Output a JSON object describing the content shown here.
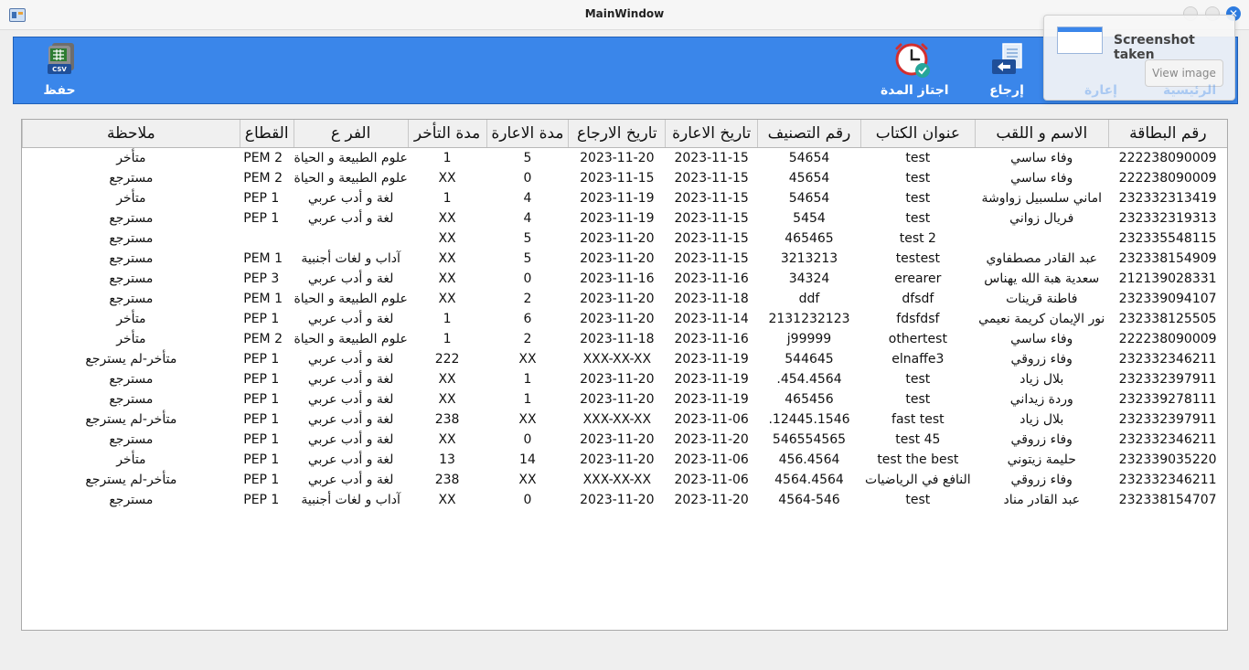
{
  "window": {
    "title": "MainWindow"
  },
  "toolbar": {
    "save_label": "حفظ",
    "overdue_label": "اجتاز المدة",
    "return_label": "إرجاع",
    "loan_label": "إعارة",
    "home_label": "الرئيسية"
  },
  "notification": {
    "title": "Screenshot taken",
    "button": "View image"
  },
  "table": {
    "headers": [
      "رقم البطاقة",
      "الاسم و اللقب",
      "عنوان الكتاب",
      "رقم التصنيف",
      "تاريخ الاعارة",
      "تاريخ الارجاع",
      "مدة الاعارة",
      "مدة التأخر",
      "الفر ع",
      "القطاع",
      "ملاحظة"
    ],
    "rows": [
      [
        "222238090009",
        "وفاء ساسي",
        "test",
        "54654",
        "2023-11-15",
        "2023-11-20",
        "5",
        "1",
        "علوم الطبيعة و الحياة",
        "PEM 2",
        "متأخر"
      ],
      [
        "222238090009",
        "وفاء ساسي",
        "test",
        "45654",
        "2023-11-15",
        "2023-11-15",
        "0",
        "XX",
        "علوم الطبيعة و الحياة",
        "PEM 2",
        "مسترجع"
      ],
      [
        "232332313419",
        "اماني سلسبيل زواوشة",
        "test",
        "54654",
        "2023-11-15",
        "2023-11-19",
        "4",
        "1",
        "لغة و أدب عربي",
        "PEP 1",
        "متأخر"
      ],
      [
        "232332319313",
        "فريال زواني",
        "test",
        "5454",
        "2023-11-15",
        "2023-11-19",
        "4",
        "XX",
        "لغة و أدب عربي",
        "PEP 1",
        "مسترجع"
      ],
      [
        "232335548115",
        "",
        "test 2",
        "465465",
        "2023-11-15",
        "2023-11-20",
        "5",
        "XX",
        "",
        "",
        "مسترجع"
      ],
      [
        "232338154909",
        "عبد القادر مصطفاوي",
        "testest",
        "3213213",
        "2023-11-15",
        "2023-11-20",
        "5",
        "XX",
        "آداب و لغات أجنبية",
        "PEM 1",
        "مسترجع"
      ],
      [
        "212139028331",
        "سعدية هبة الله يهناس",
        "erearer",
        "34324",
        "2023-11-16",
        "2023-11-16",
        "0",
        "XX",
        "لغة و أدب عربي",
        "PEP 3",
        "مسترجع"
      ],
      [
        "232339094107",
        "فاطنة قرينات",
        "dfsdf",
        "ddf",
        "2023-11-18",
        "2023-11-20",
        "2",
        "XX",
        "علوم الطبيعة و الحياة",
        "PEM 1",
        "مسترجع"
      ],
      [
        "232338125505",
        "نور الإيمان كريمة نعيمي",
        "fdsfdsf",
        "2131232123",
        "2023-11-14",
        "2023-11-20",
        "6",
        "1",
        "لغة و أدب عربي",
        "PEP 1",
        "متأخر"
      ],
      [
        "222238090009",
        "وفاء ساسي",
        "othertest",
        "j99999",
        "2023-11-16",
        "2023-11-18",
        "2",
        "1",
        "علوم الطبيعة و الحياة",
        "PEM 2",
        "متأخر"
      ],
      [
        "232332346211",
        "وفاء زروقي",
        "elnaffe3",
        "544645",
        "2023-11-19",
        "XXX-XX-XX",
        "XX",
        "222",
        "لغة و أدب عربي",
        "PEP 1",
        "متأخر-لم يسترجع"
      ],
      [
        "232332397911",
        "بلال زياد",
        "test",
        "454.4564.",
        "2023-11-19",
        "2023-11-20",
        "1",
        "XX",
        "لغة و أدب عربي",
        "PEP 1",
        "مسترجع"
      ],
      [
        "232339278111",
        "وردة زيداني",
        "test",
        "465456",
        "2023-11-19",
        "2023-11-20",
        "1",
        "XX",
        "لغة و أدب عربي",
        "PEP 1",
        "مسترجع"
      ],
      [
        "232332397911",
        "بلال زياد",
        "fast test",
        "12445.1546.",
        "2023-11-06",
        "XXX-XX-XX",
        "XX",
        "238",
        "لغة و أدب عربي",
        "PEP 1",
        "متأخر-لم يسترجع"
      ],
      [
        "232332346211",
        "وفاء زروقي",
        "test 45",
        "546554565",
        "2023-11-20",
        "2023-11-20",
        "0",
        "XX",
        "لغة و أدب عربي",
        "PEP 1",
        "مسترجع"
      ],
      [
        "232339035220",
        "حليمة زيتوني",
        "test the best",
        "456.4564",
        "2023-11-06",
        "2023-11-20",
        "14",
        "13",
        "لغة و أدب عربي",
        "PEP 1",
        "متأخر"
      ],
      [
        "232332346211",
        "وفاء زروقي",
        "النافع في الرياضيات",
        "4564.4564",
        "2023-11-06",
        "XXX-XX-XX",
        "XX",
        "238",
        "لغة و أدب عربي",
        "PEP 1",
        "متأخر-لم يسترجع"
      ],
      [
        "232338154707",
        "عبد القادر مناد",
        "test",
        "4564-546",
        "2023-11-20",
        "2023-11-20",
        "0",
        "XX",
        "آداب و لغات أجنبية",
        "PEP 1",
        "مسترجع"
      ]
    ]
  }
}
